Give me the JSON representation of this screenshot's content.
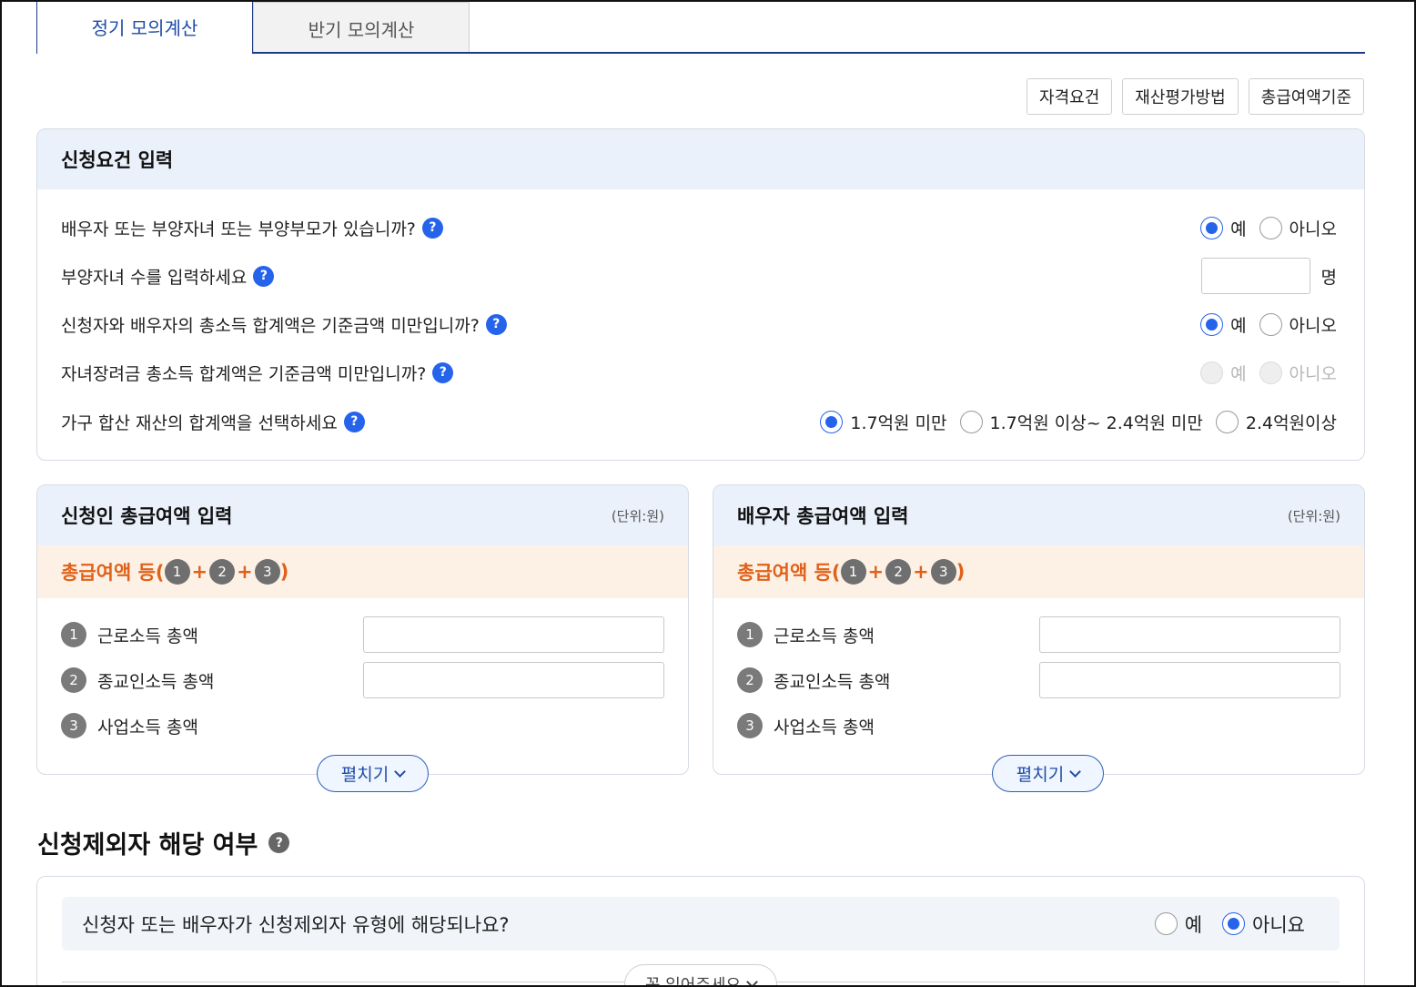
{
  "tabs": [
    {
      "label": "정기 모의계산",
      "active": true
    },
    {
      "label": "반기 모의계산",
      "active": false
    }
  ],
  "top_buttons": [
    "자격요건",
    "재산평가방법",
    "총급여액기준"
  ],
  "requirements": {
    "title": "신청요건 입력",
    "questions": [
      {
        "text": "배우자 또는 부양자녀 또는 부양부모가 있습니까?",
        "yes": "예",
        "no": "아니오",
        "selected": "yes"
      },
      {
        "text": "부양자녀 수를 입력하세요",
        "unit": "명",
        "value": ""
      },
      {
        "text": "신청자와 배우자의 총소득 합계액은 기준금액 미만입니까?",
        "yes": "예",
        "no": "아니오",
        "selected": "yes"
      },
      {
        "text": "자녀장려금 총소득 합계액은 기준금액 미만입니까?",
        "yes": "예",
        "no": "아니오",
        "selected": "disabled"
      },
      {
        "text": "가구 합산 재산의 합계액을 선택하세요",
        "options": [
          "1.7억원 미만",
          "1.7억원 이상~ 2.4억원 미만",
          "2.4억원이상"
        ],
        "selected": 0
      }
    ]
  },
  "applicant": {
    "title": "신청인 총급여액 입력",
    "unit": "(단위:원)",
    "sum_label": "총급여액 등(",
    "sum_close": ")",
    "n1": "1",
    "n2": "2",
    "n3": "3",
    "plus": "+",
    "rows": [
      {
        "num": "1",
        "label": "근로소득 총액",
        "value": ""
      },
      {
        "num": "2",
        "label": "종교인소득 총액",
        "value": ""
      },
      {
        "num": "3",
        "label": "사업소득 총액"
      }
    ],
    "expand": "펼치기"
  },
  "spouse": {
    "title": "배우자 총급여액 입력",
    "unit": "(단위:원)",
    "sum_label": "총급여액 등(",
    "sum_close": ")",
    "n1": "1",
    "n2": "2",
    "n3": "3",
    "plus": "+",
    "rows": [
      {
        "num": "1",
        "label": "근로소득 총액",
        "value": ""
      },
      {
        "num": "2",
        "label": "종교인소득 총액",
        "value": ""
      },
      {
        "num": "3",
        "label": "사업소득 총액"
      }
    ],
    "expand": "펼치기"
  },
  "exclusion": {
    "title": "신청제외자 해당 여부",
    "question": "신청자 또는 배우자가 신청제외자 유형에 해당되나요?",
    "yes": "예",
    "no": "아니요",
    "selected": "no",
    "read_button": "꼭 읽어주세요"
  },
  "colors": {
    "accent": "#2563eb",
    "tab_active": "#1f4ca8",
    "orange": "#e0621a",
    "head_bg": "#eaf1fb",
    "sum_bg": "#fdf1e6"
  },
  "icons": [
    "help-icon",
    "chevron-down-icon",
    "radio-icon"
  ]
}
